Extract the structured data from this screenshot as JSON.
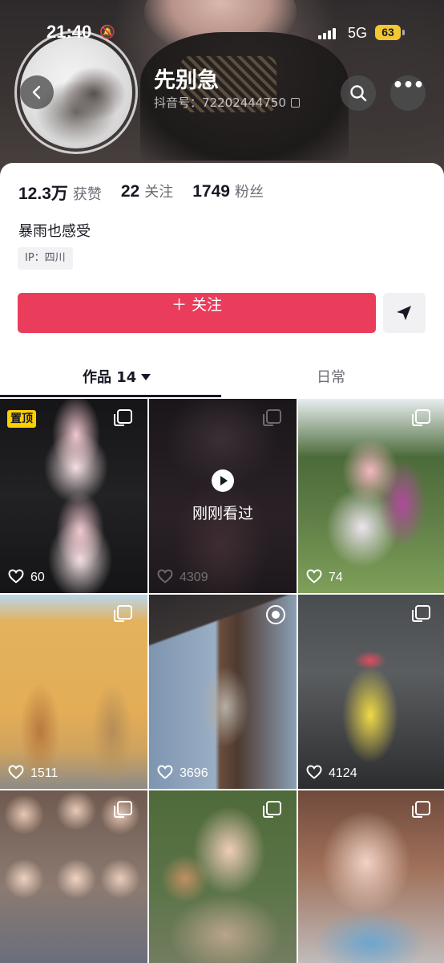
{
  "status_bar": {
    "time": "21:40",
    "network": "5G",
    "battery": "63"
  },
  "profile": {
    "nickname": "先别急",
    "douyin_id": "抖音号：72202444750",
    "stats": [
      {
        "value": "12.3万",
        "label": "获赞"
      },
      {
        "value": "22",
        "label": "关注"
      },
      {
        "value": "1749",
        "label": "粉丝"
      }
    ],
    "bio": "暴雨也感受",
    "ip": "IP：四川",
    "follow_label": "＋ 关注"
  },
  "tabs": [
    {
      "label": "作品 14",
      "active": true
    },
    {
      "label": "日常",
      "active": false
    }
  ],
  "videos": [
    {
      "likes": "60",
      "badge": "置顶",
      "corner_icon": "multi-image-icon"
    },
    {
      "likes": "4309",
      "overlay": "刚刚看过",
      "corner_icon": "multi-image-icon"
    },
    {
      "likes": "74",
      "corner_icon": "multi-image-icon"
    },
    {
      "likes": "1511",
      "corner_icon": "multi-image-icon"
    },
    {
      "likes": "3696",
      "corner_icon": "live-photo-icon"
    },
    {
      "likes": "4124",
      "corner_icon": "multi-image-icon"
    },
    {
      "likes": "",
      "corner_icon": "multi-image-icon"
    },
    {
      "likes": "",
      "corner_icon": "multi-image-icon"
    },
    {
      "likes": "",
      "corner_icon": "multi-image-icon"
    }
  ],
  "colors": {
    "follow_button": "#ea3d5c",
    "pin_badge": "#fbd000",
    "battery": "#f3c733"
  }
}
